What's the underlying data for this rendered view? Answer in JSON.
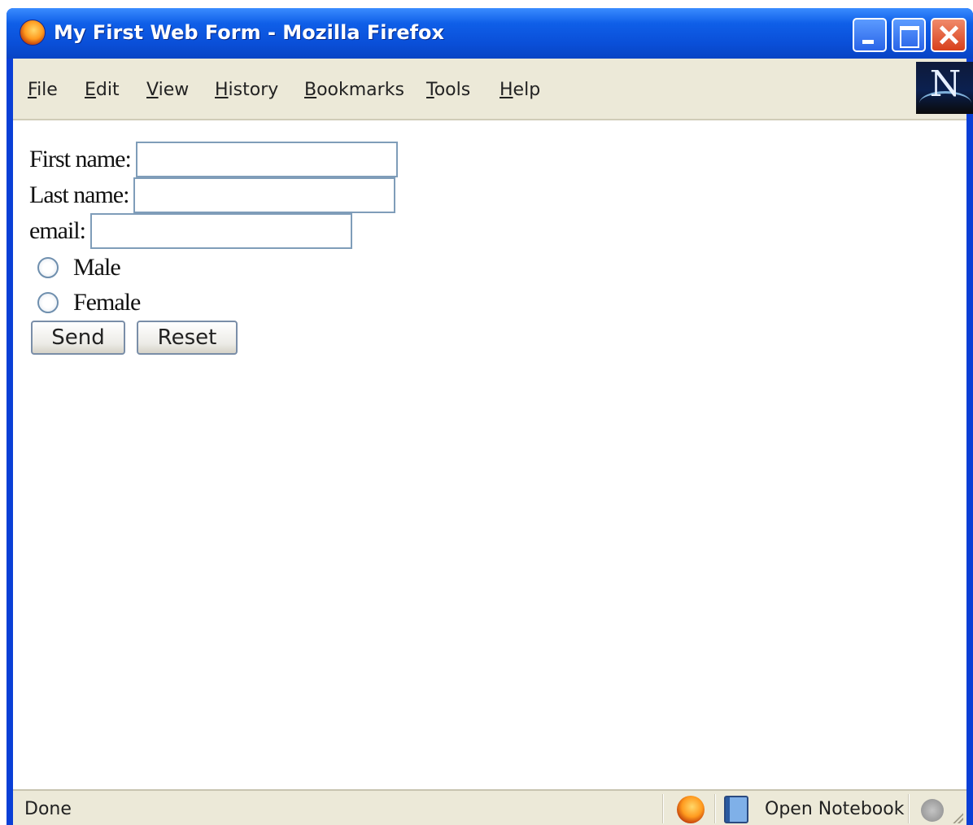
{
  "window": {
    "title": "My First Web Form - Mozilla Firefox",
    "icons": {
      "app": "firefox-icon",
      "minimize": "minimize-icon",
      "maximize": "maximize-icon",
      "close": "close-icon"
    }
  },
  "menubar": {
    "items": [
      {
        "label": "File"
      },
      {
        "label": "Edit"
      },
      {
        "label": "View"
      },
      {
        "label": "History"
      },
      {
        "label": "Bookmarks"
      },
      {
        "label": "Tools"
      },
      {
        "label": "Help"
      }
    ],
    "throbber_logo": "N"
  },
  "form": {
    "first_name_label": "First name:",
    "first_name_value": "",
    "last_name_label": "Last name:",
    "last_name_value": "",
    "email_label": "email:",
    "email_value": "",
    "gender_options": [
      {
        "label": "Male",
        "checked": false
      },
      {
        "label": "Female",
        "checked": false
      }
    ],
    "send_label": "Send",
    "reset_label": "Reset"
  },
  "statusbar": {
    "status_text": "Done",
    "notebook_label": "Open Notebook",
    "icons": [
      "firefox-icon",
      "notebook-icon",
      "pen-icon"
    ]
  },
  "colors": {
    "titlebar_blue": "#0a4fd8",
    "chrome_beige": "#ece9d8",
    "input_border": "#7f9db9"
  }
}
